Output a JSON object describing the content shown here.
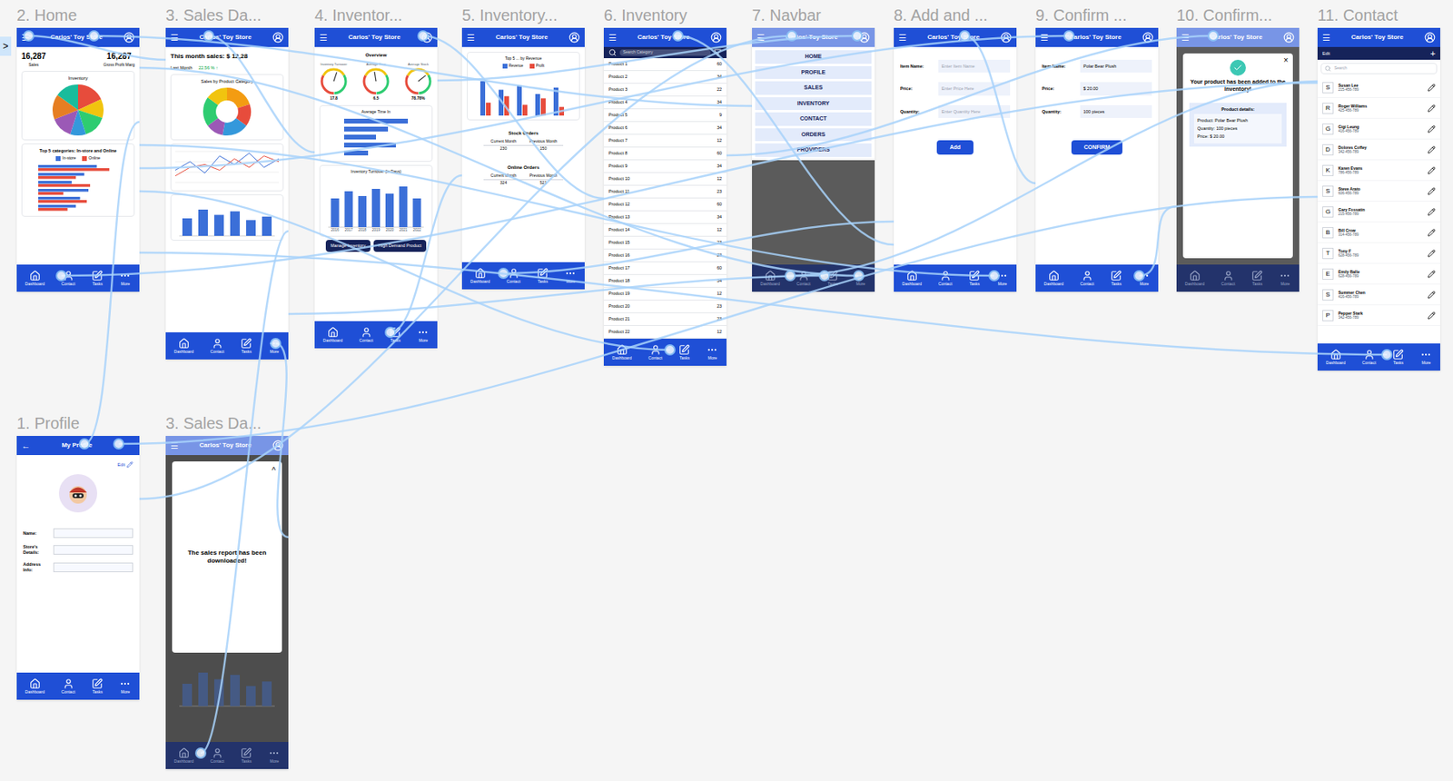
{
  "start_marker": ">",
  "nav": [
    {
      "label": "Dashboard"
    },
    {
      "label": "Contact"
    },
    {
      "label": "Tasks"
    },
    {
      "label": "More"
    }
  ],
  "frames": [
    {
      "label": "2. Home",
      "kind": "home",
      "dimmed": false,
      "header": {
        "left": "☰",
        "title": "Carlos' Toy Store",
        "avatar": true
      },
      "stats": [
        {
          "value": "16,287",
          "label": "Sales"
        },
        {
          "value": "16,287",
          "label": "Gross Profit Marg"
        }
      ],
      "pie": {
        "title": "Inventory",
        "values": [
          18,
          12,
          15,
          10,
          14,
          16,
          15
        ],
        "colors": [
          "#e74c3c",
          "#f1c40f",
          "#2ecc71",
          "#3498db",
          "#9b59b6",
          "#e67e22",
          "#1abc9c"
        ]
      },
      "bars": {
        "title": "Top 5 categories: In-store and Online",
        "legend": [
          "In-store",
          "Online"
        ],
        "colors": [
          "#3b6fd8",
          "#e74c3c"
        ],
        "series": [
          [
            70,
            55,
            40,
            60,
            50,
            45
          ],
          [
            85,
            45,
            62,
            30,
            58,
            35
          ]
        ]
      }
    },
    {
      "label": "3. Sales Da...",
      "kind": "sales",
      "dimmed": false,
      "header": {
        "left": "☰",
        "title": "Carlos' Toy Store",
        "avatar": true
      },
      "headline": "This month sales: $ 12,28",
      "last_month": "Last Month",
      "change": "22.56 %",
      "change_icon": "↑",
      "donut": {
        "title": "Sales by Product Category",
        "values": [
          20,
          15,
          18,
          12,
          20,
          15
        ],
        "colors": [
          "#f39c12",
          "#e74c3c",
          "#3498db",
          "#9b59b6",
          "#2ecc71",
          "#f1c40f"
        ]
      },
      "line": {
        "colors": [
          "#3b6fd8",
          "#e74c3c"
        ],
        "series": [
          [
            30,
            45,
            25,
            55,
            40,
            60,
            35,
            50
          ],
          [
            20,
            35,
            40,
            30,
            50,
            35,
            55,
            45
          ]
        ]
      },
      "bars": {
        "color": "#3b6fd8",
        "values": [
          50,
          75,
          60,
          70,
          45,
          55
        ]
      }
    },
    {
      "label": "4. Inventor...",
      "kind": "inventory4",
      "dimmed": false,
      "header": {
        "left": "☰",
        "title": "Carlos' Toy Store",
        "avatar": true
      },
      "overview": "Overview",
      "gauges": [
        {
          "label": "Inventory Turnover",
          "value": "17.8",
          "level": 0.6
        },
        {
          "label": "Average Time",
          "value": "6.5",
          "level": 0.45
        },
        {
          "label": "Average Stock",
          "value": "78.78%",
          "level": 0.79
        }
      ],
      "avg_title": "Average Time In",
      "avg_bars": [
        80,
        55,
        40,
        65,
        30
      ],
      "turnover": {
        "title": "Inventory Turnover (In Days)",
        "values": [
          60,
          75,
          65,
          80,
          70,
          85,
          60
        ],
        "years": [
          "2016",
          "2017",
          "2018",
          "2019",
          "2020",
          "2021",
          "2022"
        ]
      },
      "buttons": [
        "Manage Inventory",
        "High Demand Product"
      ]
    },
    {
      "label": "5. Inventory...",
      "kind": "inventory5",
      "dimmed": false,
      "header": {
        "left": "☰",
        "title": "Carlos' Toy Store",
        "avatar": true
      },
      "chart_title": "Top 5 ... by Revenue",
      "legend": [
        "Revenue",
        "Profit"
      ],
      "colors": [
        "#3b6fd8",
        "#e74c3c"
      ],
      "series": [
        [
          80,
          60,
          70,
          50,
          65
        ],
        [
          30,
          45,
          25,
          40,
          20
        ]
      ],
      "tables": [
        {
          "title": "Stock Orders",
          "columns": [
            "Current Month",
            "Previous Month"
          ],
          "values": [
            "230",
            "150"
          ]
        },
        {
          "title": "Online Orders",
          "columns": [
            "Current Month",
            "Previous Month"
          ],
          "values": [
            "324",
            "521"
          ]
        }
      ]
    },
    {
      "label": "6. Inventory",
      "kind": "inventory6",
      "dimmed": false,
      "header": {
        "left": "☰",
        "title": "Carlos' Toy Store",
        "avatar": true
      },
      "search_placeholder": "Search Category",
      "rows": [
        {
          "name": "Product 1",
          "qty": "60"
        },
        {
          "name": "Product 2",
          "qty": "34"
        },
        {
          "name": "Product 3",
          "qty": "22"
        },
        {
          "name": "Product 4",
          "qty": "34"
        },
        {
          "name": "Product 5",
          "qty": "9"
        },
        {
          "name": "Product 6",
          "qty": "34"
        },
        {
          "name": "Product 7",
          "qty": "12"
        },
        {
          "name": "Product 8",
          "qty": "60"
        },
        {
          "name": "Product 9",
          "qty": "34"
        },
        {
          "name": "Product 10",
          "qty": "12"
        },
        {
          "name": "Product 11",
          "qty": "23"
        },
        {
          "name": "Product 12",
          "qty": "60"
        },
        {
          "name": "Product 13",
          "qty": "34"
        },
        {
          "name": "Product 14",
          "qty": "12"
        },
        {
          "name": "Product 15",
          "qty": "23"
        },
        {
          "name": "Product 16",
          "qty": "23"
        },
        {
          "name": "Product 17",
          "qty": "60"
        },
        {
          "name": "Product 18",
          "qty": "34"
        },
        {
          "name": "Product 19",
          "qty": "12"
        },
        {
          "name": "Product 20",
          "qty": "23"
        },
        {
          "name": "Product 21",
          "qty": "23"
        },
        {
          "name": "Product 22",
          "qty": "12"
        }
      ]
    },
    {
      "label": "7. Navbar",
      "kind": "navbar",
      "dimmed": true,
      "header": {
        "left": "☰",
        "title": "Carlos' Toy Store",
        "avatar": true
      },
      "items": [
        "HOME",
        "PROFILE",
        "SALES",
        "INVENTORY",
        "CONTACT",
        "ORDERS",
        "PROVIDERS"
      ]
    },
    {
      "label": "8. Add and ...",
      "kind": "form",
      "dimmed": false,
      "header": {
        "left": "☰",
        "title": "Carlos' Toy Store",
        "avatar": true
      },
      "fields": [
        {
          "label": "Item Name:",
          "placeholder": "Enter Item Name",
          "value": ""
        },
        {
          "label": "Price:",
          "placeholder": "Enter Price Here",
          "value": ""
        },
        {
          "label": "Quantity:",
          "placeholder": "Enter Quantity Here",
          "value": ""
        }
      ],
      "button": "Add"
    },
    {
      "label": "9. Confirm ...",
      "kind": "form",
      "dimmed": false,
      "header": {
        "left": "☰",
        "title": "Carlos' Toy Store",
        "avatar": true
      },
      "fields": [
        {
          "label": "Item Name:",
          "placeholder": "",
          "value": "Polar Bear Plush"
        },
        {
          "label": "Price:",
          "placeholder": "",
          "value": "$ 20.00"
        },
        {
          "label": "Quantity:",
          "placeholder": "",
          "value": "100 pieces"
        }
      ],
      "button": "CONFIRM"
    },
    {
      "label": "10. Confirm...",
      "kind": "confirm",
      "dimmed": true,
      "header": {
        "left": "☰",
        "title": "Carlos' Toy Store",
        "avatar": true
      },
      "close": "×",
      "message": "Your product has been added to the inventory!",
      "details_title": "Product details:",
      "details": [
        "Product: Polar Bear Plush",
        "Quantity: 100 pieces",
        "Price: $ 20.00"
      ]
    },
    {
      "label": "11. Contact",
      "kind": "contact",
      "dimmed": false,
      "header": {
        "left": "☰",
        "title": "Carlos' Toy Store",
        "avatar": true
      },
      "edit": "Edit",
      "add": "+",
      "search_placeholder": "Search",
      "contacts": [
        {
          "initial": "S",
          "name": "Susan Lee",
          "phone": "215-456-789"
        },
        {
          "initial": "R",
          "name": "Roger Williams",
          "phone": "425-456-789"
        },
        {
          "initial": "G",
          "name": "Gigi Leung",
          "phone": "416-456-789"
        },
        {
          "initial": "D",
          "name": "Dolores Coffey",
          "phone": "342-456-789"
        },
        {
          "initial": "K",
          "name": "Karen Evans",
          "phone": "786-456-789"
        },
        {
          "initial": "S",
          "name": "Steve Arato",
          "phone": "606-456-789"
        },
        {
          "initial": "G",
          "name": "Gary Fossatin",
          "phone": "215-456-789"
        },
        {
          "initial": "B",
          "name": "Bill Crow",
          "phone": "314-456-789"
        },
        {
          "initial": "T",
          "name": "Tony F",
          "phone": "628-456-789"
        },
        {
          "initial": "E",
          "name": "Emily Balle",
          "phone": "628-456-789"
        },
        {
          "initial": "S",
          "name": "Summer Chen",
          "phone": "416-456-789"
        },
        {
          "initial": "P",
          "name": "Pepper Stark",
          "phone": "342-456-789"
        }
      ]
    },
    {
      "label": "1. Profile",
      "kind": "profile",
      "dimmed": false,
      "header": {
        "left": "←",
        "title": "My Profile",
        "avatar": false
      },
      "edit": "Edit",
      "fields": [
        "Name:",
        "Store's Details:",
        "Address Info:"
      ]
    },
    {
      "label": "3. Sales Da...",
      "kind": "popup",
      "dimmed": true,
      "header": {
        "left": "☰",
        "title": "Carlos' Toy Store",
        "avatar": true
      },
      "close": "^",
      "message": "The sales report has been downloaded!",
      "bars": [
        50,
        75,
        60,
        70,
        45,
        55
      ]
    }
  ],
  "connections": [
    {
      "from": 0,
      "to": 1
    },
    {
      "from": 0,
      "to": 9
    },
    {
      "from": 0,
      "to": 5
    },
    {
      "from": 1,
      "to": 11
    },
    {
      "from": 1,
      "to": 2
    },
    {
      "from": 2,
      "to": 3
    },
    {
      "from": 2,
      "to": 4
    },
    {
      "from": 3,
      "to": 6
    },
    {
      "from": 4,
      "to": 6
    },
    {
      "from": 5,
      "to": 0
    },
    {
      "from": 5,
      "to": 10
    },
    {
      "from": 5,
      "to": 1
    },
    {
      "from": 5,
      "to": 2
    },
    {
      "from": 5,
      "to": 9
    },
    {
      "from": 6,
      "to": 7
    },
    {
      "from": 7,
      "to": 8
    },
    {
      "from": 8,
      "to": 4
    },
    {
      "from": 9,
      "to": 0
    },
    {
      "from": 10,
      "to": 9
    },
    {
      "from": 11,
      "to": 1
    },
    {
      "from": 10,
      "to": 0
    },
    {
      "from": 6,
      "to": 0
    },
    {
      "from": 7,
      "to": 0
    },
    {
      "from": 4,
      "to": 0
    }
  ]
}
